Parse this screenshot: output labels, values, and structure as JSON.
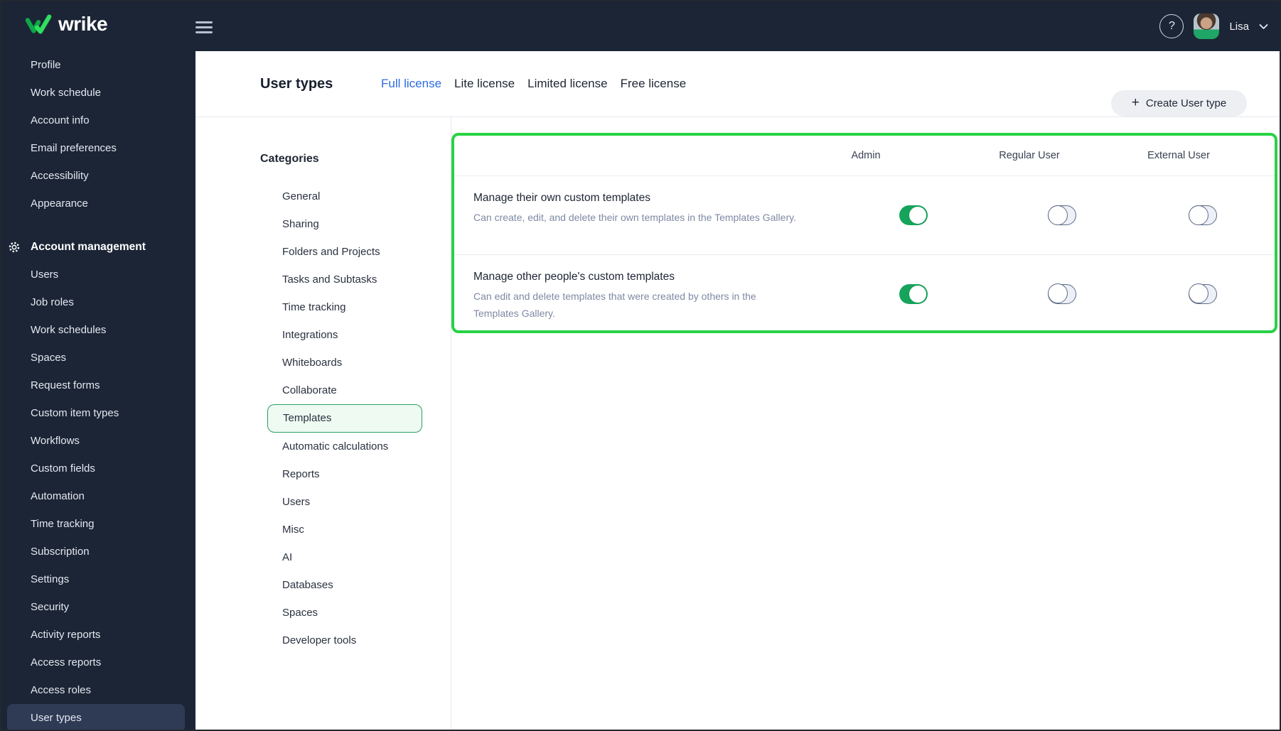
{
  "topbar": {
    "brand": "wrike",
    "help_label": "?",
    "user_name": "Lisa"
  },
  "sidebar": {
    "items": [
      {
        "label": "Profile"
      },
      {
        "label": "Work schedule"
      },
      {
        "label": "Account info"
      },
      {
        "label": "Email preferences"
      },
      {
        "label": "Accessibility"
      },
      {
        "label": "Appearance"
      },
      {
        "label": "Account management",
        "type": "section"
      },
      {
        "label": "Users"
      },
      {
        "label": "Job roles"
      },
      {
        "label": "Work schedules"
      },
      {
        "label": "Spaces"
      },
      {
        "label": "Request forms"
      },
      {
        "label": "Custom item types"
      },
      {
        "label": "Workflows"
      },
      {
        "label": "Custom fields"
      },
      {
        "label": "Automation"
      },
      {
        "label": "Time tracking"
      },
      {
        "label": "Subscription"
      },
      {
        "label": "Settings"
      },
      {
        "label": "Security"
      },
      {
        "label": "Activity reports"
      },
      {
        "label": "Access reports"
      },
      {
        "label": "Access roles"
      },
      {
        "label": "User types",
        "selected": true
      }
    ]
  },
  "page": {
    "title": "User types",
    "tabs": [
      {
        "label": "Full license",
        "active": true
      },
      {
        "label": "Lite license",
        "active": false
      },
      {
        "label": "Limited license",
        "active": false
      },
      {
        "label": "Free license",
        "active": false
      }
    ],
    "create_button": "Create User type"
  },
  "categories": {
    "heading": "Categories",
    "items": [
      {
        "label": "General"
      },
      {
        "label": "Sharing"
      },
      {
        "label": "Folders and Projects"
      },
      {
        "label": "Tasks and Subtasks"
      },
      {
        "label": "Time tracking"
      },
      {
        "label": "Integrations"
      },
      {
        "label": "Whiteboards"
      },
      {
        "label": "Collaborate"
      },
      {
        "label": "Templates",
        "selected": true
      },
      {
        "label": "Automatic calculations"
      },
      {
        "label": "Reports"
      },
      {
        "label": "Users"
      },
      {
        "label": "Misc"
      },
      {
        "label": "AI"
      },
      {
        "label": "Databases"
      },
      {
        "label": "Spaces"
      },
      {
        "label": "Developer tools"
      }
    ]
  },
  "permissions": {
    "columns": [
      "Admin",
      "Regular User",
      "External User"
    ],
    "rows": [
      {
        "title": "Manage their own custom templates",
        "description": "Can create, edit, and delete their own templates in the Templates Gallery.",
        "toggles": [
          true,
          false,
          false
        ]
      },
      {
        "title": "Manage other people's custom templates",
        "description": "Can edit and delete templates that were created by others in the Templates Gallery.",
        "toggles": [
          true,
          false,
          false
        ]
      }
    ]
  },
  "colors": {
    "annotation_green": "#28d245",
    "toggle_on_green": "#16a45c",
    "active_tab_blue": "#2e6be0",
    "navy": "#1c2536"
  }
}
